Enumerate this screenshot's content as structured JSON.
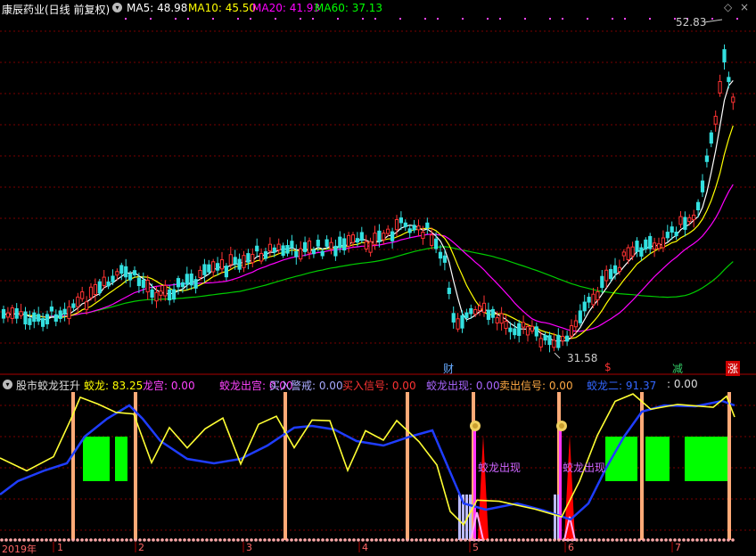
{
  "header": {
    "title": "康辰药业(日线 前复权)",
    "ma5_label": "MA5:",
    "ma5_value": "48.98",
    "ma5_color": "#ffffff",
    "ma10_label": "MA10:",
    "ma10_value": "45.50",
    "ma10_color": "#ffff00",
    "ma20_label": "MA20:",
    "ma20_value": "41.93",
    "ma20_color": "#ff00ff",
    "ma60_label": "MA60:",
    "ma60_value": "37.13",
    "ma60_color": "#00ff00"
  },
  "price_panel": {
    "high_label": "52.83",
    "low_label": "31.58",
    "markers": [
      {
        "text": "财",
        "color": "#66aaff"
      },
      {
        "text": "$",
        "color": "#ff3333"
      },
      {
        "text": "减",
        "color": "#33cc66"
      },
      {
        "text": "涨",
        "color": "#ffffff",
        "bg": "#cc0000"
      }
    ]
  },
  "indicator_panel": {
    "name": "股市蛟龙狂升",
    "items": [
      {
        "label": "蛟龙:",
        "value": "83.25",
        "color": "#ffff00"
      },
      {
        "label": "龙宫:",
        "value": "0.00",
        "color": "#ff44ff"
      },
      {
        "label": "蛟龙出宫:",
        "value": "0.00",
        "color": "#ff44ff"
      },
      {
        "label": "买入警戒:",
        "value": "0.00",
        "color": "#aaaaff"
      },
      {
        "label": "买入信号:",
        "value": "0.00",
        "color": "#ff3333"
      },
      {
        "label": "蛟龙出现:",
        "value": "0.00",
        "color": "#aa66ff"
      },
      {
        "label": "卖出信号:",
        "value": "0.00",
        "color": "#ffaa44"
      },
      {
        "label": "蛟龙二:",
        "value": "91.37",
        "color": "#3366ff"
      },
      {
        "label": ":",
        "value": "0.00",
        "color": "#dddddd"
      }
    ],
    "annotation_1": "蛟龙出现",
    "annotation_2": "蛟龙出现",
    "annotation_color": "#cc66ff"
  },
  "time_axis": {
    "year_label": "2019年",
    "months": [
      "1",
      "2",
      "3",
      "4",
      "5",
      "6",
      "7"
    ]
  }
}
